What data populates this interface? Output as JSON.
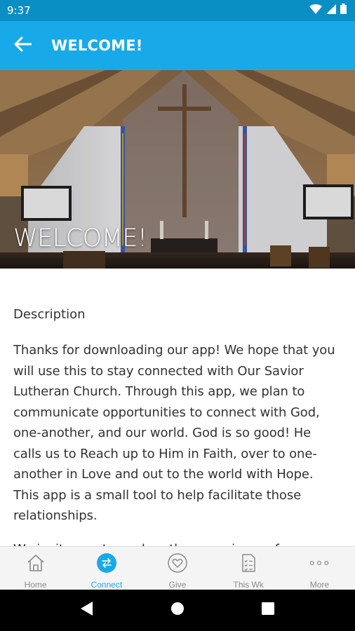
{
  "status_bar": {
    "time": "9:37"
  },
  "app_bar": {
    "title": "WELCOME!"
  },
  "hero": {
    "title": "WELCOME!"
  },
  "content": {
    "heading": "Description",
    "paragraphs": [
      "Thanks for downloading our app!  We hope that you will use this to stay connected with Our Savior Lutheran Church.  Through this app, we plan to communicate opportunities to connect with God, one-another, and our world.  God is so good!  He calls us to Reach up to Him in Faith, over to one-another in Love and out to the world with Hope.  This app is a small tool to help facilitate those relationships.",
      "We invite you to explore the app, sign up for notifications that fit your needs and interests, and"
    ]
  },
  "bottom_nav": {
    "items": [
      {
        "label": "Home",
        "icon": "home-icon"
      },
      {
        "label": "Connect",
        "icon": "connect-icon"
      },
      {
        "label": "Give",
        "icon": "give-icon"
      },
      {
        "label": "This Wk",
        "icon": "checklist-icon"
      },
      {
        "label": "More",
        "icon": "more-icon"
      }
    ],
    "active_index": 1
  },
  "colors": {
    "status_bar": "#0a8fc4",
    "app_bar": "#18aae8",
    "accent": "#18aae8",
    "text": "#333333",
    "nav_inactive": "#8a8a8a"
  }
}
